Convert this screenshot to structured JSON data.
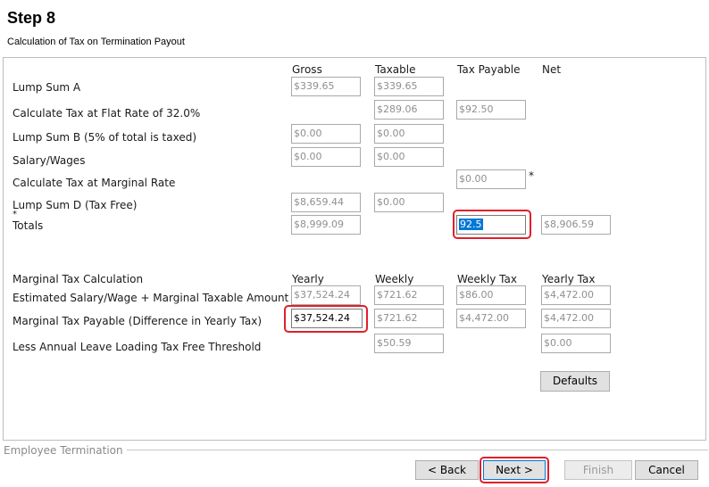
{
  "header": {
    "title": "Step 8",
    "subtitle": "Calculation of Tax on Termination Payout"
  },
  "columns": {
    "gross": "Gross",
    "taxable": "Taxable",
    "tax_payable": "Tax Payable",
    "net": "Net"
  },
  "rows": {
    "lump_sum_a": {
      "label": "Lump Sum A",
      "gross": "$339.65",
      "taxable": "$339.65"
    },
    "flat_rate": {
      "label": "Calculate Tax at Flat Rate of 32.0%",
      "taxable": "$289.06",
      "tax_payable": "$92.50"
    },
    "lump_sum_b": {
      "label": "Lump Sum B (5% of total is taxed)",
      "gross": "$0.00",
      "taxable": "$0.00"
    },
    "salary": {
      "label": "Salary/Wages",
      "gross": "$0.00",
      "taxable": "$0.00"
    },
    "marginal": {
      "label": "Calculate Tax at Marginal Rate",
      "tax_payable": "$0.00",
      "asterisk": "*"
    },
    "lump_sum_d": {
      "label": "Lump Sum D (Tax Free)",
      "gross": "$8,659.44",
      "taxable": "$0.00"
    },
    "totals": {
      "label": "Totals",
      "asterisk": "*",
      "gross": "$8,999.09",
      "tax_payable": "92.5",
      "net": "$8,906.59"
    }
  },
  "marginal_section": {
    "title": "Marginal Tax Calculation",
    "columns": {
      "yearly": "Yearly",
      "weekly": "Weekly",
      "weekly_tax": "Weekly Tax",
      "yearly_tax": "Yearly Tax"
    },
    "estimated": {
      "label": "Estimated Salary/Wage + Marginal Taxable Amount",
      "yearly": "$37,524.24",
      "weekly": "$721.62",
      "weekly_tax": "$86.00",
      "yearly_tax": "$4,472.00"
    },
    "payable": {
      "label": "Marginal Tax Payable (Difference in Yearly Tax)",
      "yearly": "$37,524.24",
      "weekly": "$721.62",
      "weekly_tax": "$4,472.00",
      "yearly_tax": "$4,472.00"
    },
    "leave": {
      "label": "Less Annual Leave Loading Tax Free Threshold",
      "weekly": "$50.59",
      "yearly_tax": "$0.00"
    },
    "defaults_label": "Defaults"
  },
  "footer": {
    "group_label": "Employee Termination",
    "back_label": "< Back",
    "next_label": "Next >",
    "finish_label": "Finish",
    "cancel_label": "Cancel"
  },
  "colors": {
    "highlight": "#e0202a",
    "selection": "#0078d7"
  }
}
